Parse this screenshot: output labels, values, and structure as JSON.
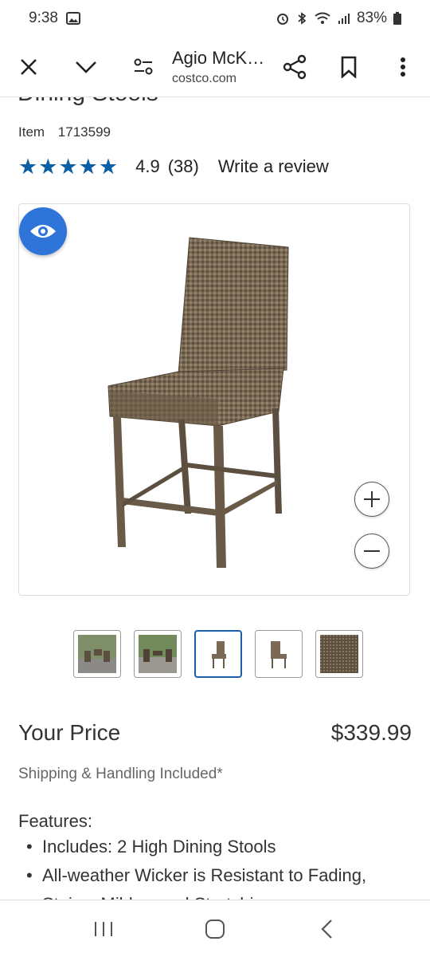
{
  "status": {
    "time": "9:38",
    "battery": "83%"
  },
  "browser": {
    "title": "Agio McK…",
    "url": "costco.com"
  },
  "product": {
    "title_cut": "Dining Stools",
    "item_label": "Item",
    "item_number": "1713599",
    "rating": "4.9",
    "review_count": "(38)",
    "write_review": "Write a review",
    "stars": 5
  },
  "price": {
    "label": "Your Price",
    "value": "$339.99",
    "shipping": "Shipping & Handling Included*"
  },
  "features": {
    "title": "Features:",
    "items": [
      "Includes: 2 High Dining Stools",
      "All-weather Wicker is Resistant to Fading,",
      "Stains, Mildew and Stretching"
    ]
  },
  "colors": {
    "star": "#0b5fa5",
    "eye_button": "#2e74d9",
    "thumb_selected": "#1a5fa7"
  },
  "icons": [
    "close-icon",
    "chevron-down-icon",
    "tune-icon",
    "share-icon",
    "bookmark-icon",
    "more-vert-icon",
    "eye-icon",
    "zoom-in-icon",
    "zoom-out-icon",
    "recents-icon",
    "home-icon",
    "back-icon"
  ]
}
